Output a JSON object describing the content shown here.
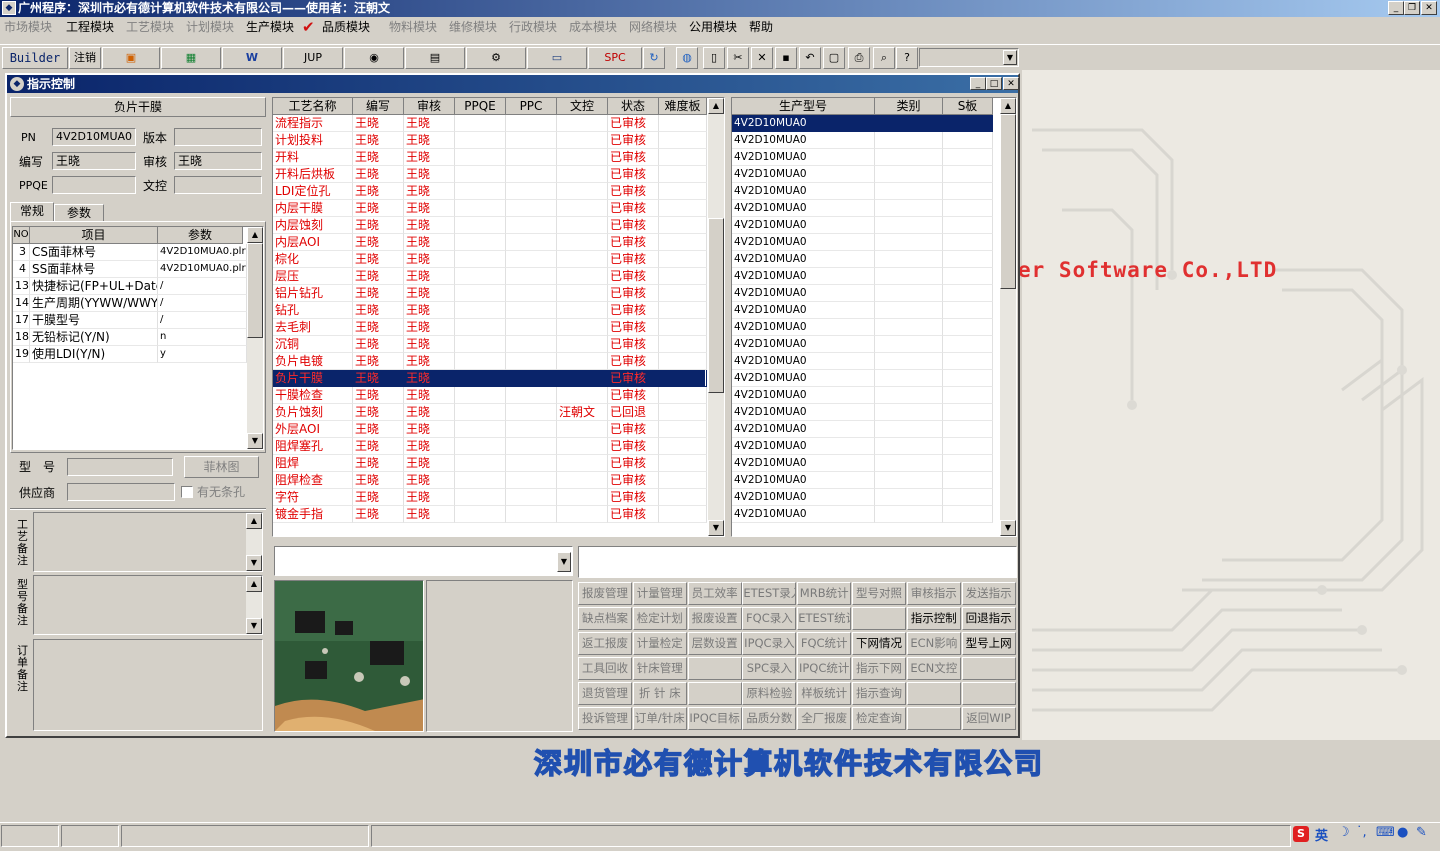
{
  "window": {
    "title": "广州程序：深圳市必有德计算机软件技术有限公司——使用者：汪朝文"
  },
  "menu": [
    {
      "label": "市场模块",
      "enabled": false
    },
    {
      "label": "工程模块",
      "enabled": true
    },
    {
      "label": "工艺模块",
      "enabled": false
    },
    {
      "label": "计划模块",
      "enabled": false
    },
    {
      "label": "生产模块",
      "enabled": true
    },
    {
      "label": "品质模块",
      "enabled": true
    },
    {
      "label": "物料模块",
      "enabled": false
    },
    {
      "label": "维修模块",
      "enabled": false
    },
    {
      "label": "行政模块",
      "enabled": false
    },
    {
      "label": "成本模块",
      "enabled": false
    },
    {
      "label": "网络模块",
      "enabled": false
    },
    {
      "label": "公用模块",
      "enabled": true
    },
    {
      "label": "帮助",
      "enabled": true
    }
  ],
  "toolbar": {
    "builder": "Builder",
    "logout": "注销",
    "jup": "JUP",
    "spc": "SPC"
  },
  "child": {
    "title": "指示控制"
  },
  "left": {
    "panel_title": "负片干膜",
    "pn_label": "PN",
    "pn_value": "4V2D10MUA0",
    "version_label": "版本",
    "version_value": "",
    "author_label": "编写",
    "author_value": "王晓",
    "reviewer_label": "审核",
    "reviewer_value": "王晓",
    "ppqe_label": "PPQE",
    "ppqe_value": "",
    "doc_label": "文控",
    "doc_value": "",
    "tabs": [
      "常规",
      "参数"
    ],
    "param_headers": [
      "NO",
      "项目",
      "参数"
    ],
    "params": [
      {
        "no": "3",
        "item": "CS面菲林号",
        "value": "4V2D10MUA0.plr"
      },
      {
        "no": "4",
        "item": "SS面菲林号",
        "value": "4V2D10MUA0.plr"
      },
      {
        "no": "13",
        "item": "快捷标记(FP+UL+DateC",
        "value": "/"
      },
      {
        "no": "14",
        "item": "生产周期(YYWW/WWYY)",
        "value": "/"
      },
      {
        "no": "17",
        "item": "干膜型号",
        "value": "/"
      },
      {
        "no": "18",
        "item": "无铅标记(Y/N)",
        "value": "n"
      },
      {
        "no": "19",
        "item": "使用LDI(Y/N)",
        "value": "y"
      }
    ],
    "model_label": "型　号",
    "film_button": "菲林图",
    "supplier_label": "供应商",
    "slot_checkbox": "有无条孔",
    "memo_labels": [
      "工艺备注",
      "型号备注",
      "订单备注"
    ]
  },
  "process": {
    "headers": [
      "工艺名称",
      "编写",
      "审核",
      "PPQE",
      "PPC",
      "文控",
      "状态",
      "难度板"
    ],
    "rows": [
      [
        "流程指示",
        "王晓",
        "王晓",
        "",
        "",
        "",
        "已审核",
        ""
      ],
      [
        "计划投料",
        "王晓",
        "王晓",
        "",
        "",
        "",
        "已审核",
        ""
      ],
      [
        "开料",
        "王晓",
        "王晓",
        "",
        "",
        "",
        "已审核",
        ""
      ],
      [
        "开料后烘板",
        "王晓",
        "王晓",
        "",
        "",
        "",
        "已审核",
        ""
      ],
      [
        "LDI定位孔",
        "王晓",
        "王晓",
        "",
        "",
        "",
        "已审核",
        ""
      ],
      [
        "内层干膜",
        "王晓",
        "王晓",
        "",
        "",
        "",
        "已审核",
        ""
      ],
      [
        "内层蚀刻",
        "王晓",
        "王晓",
        "",
        "",
        "",
        "已审核",
        ""
      ],
      [
        "内层AOI",
        "王晓",
        "王晓",
        "",
        "",
        "",
        "已审核",
        ""
      ],
      [
        "棕化",
        "王晓",
        "王晓",
        "",
        "",
        "",
        "已审核",
        ""
      ],
      [
        "层压",
        "王晓",
        "王晓",
        "",
        "",
        "",
        "已审核",
        ""
      ],
      [
        "铝片钻孔",
        "王晓",
        "王晓",
        "",
        "",
        "",
        "已审核",
        ""
      ],
      [
        "钻孔",
        "王晓",
        "王晓",
        "",
        "",
        "",
        "已审核",
        ""
      ],
      [
        "去毛刺",
        "王晓",
        "王晓",
        "",
        "",
        "",
        "已审核",
        ""
      ],
      [
        "沉铜",
        "王晓",
        "王晓",
        "",
        "",
        "",
        "已审核",
        ""
      ],
      [
        "负片电镀",
        "王晓",
        "王晓",
        "",
        "",
        "",
        "已审核",
        ""
      ],
      [
        "负片干膜",
        "王晓",
        "王晓",
        "",
        "",
        "",
        "已审核",
        ""
      ],
      [
        "干膜检查",
        "王晓",
        "王晓",
        "",
        "",
        "",
        "已审核",
        ""
      ],
      [
        "负片蚀刻",
        "王晓",
        "王晓",
        "",
        "",
        "汪朝文",
        "已回退",
        ""
      ],
      [
        "外层AOI",
        "王晓",
        "王晓",
        "",
        "",
        "",
        "已审核",
        ""
      ],
      [
        "阻焊塞孔",
        "王晓",
        "王晓",
        "",
        "",
        "",
        "已审核",
        ""
      ],
      [
        "阻焊",
        "王晓",
        "王晓",
        "",
        "",
        "",
        "已审核",
        ""
      ],
      [
        "阻焊检查",
        "王晓",
        "王晓",
        "",
        "",
        "",
        "已审核",
        ""
      ],
      [
        "字符",
        "王晓",
        "王晓",
        "",
        "",
        "",
        "已审核",
        ""
      ],
      [
        "镀金手指",
        "王晓",
        "王晓",
        "",
        "",
        "",
        "已审核",
        ""
      ]
    ],
    "selected": 15
  },
  "models": {
    "headers": [
      "生产型号",
      "类别",
      "S板"
    ],
    "rows": [
      "4V2D10MUA0",
      "4V2D10MUA0",
      "4V2D10MUA0",
      "4V2D10MUA0",
      "4V2D10MUA0",
      "4V2D10MUA0",
      "4V2D10MUA0",
      "4V2D10MUA0",
      "4V2D10MUA0",
      "4V2D10MUA0",
      "4V2D10MUA0",
      "4V2D10MUA0",
      "4V2D10MUA0",
      "4V2D10MUA0",
      "4V2D10MUA0",
      "4V2D10MUA0",
      "4V2D10MUA0",
      "4V2D10MUA0",
      "4V2D10MUA0",
      "4V2D10MUA0",
      "4V2D10MUA0",
      "4V2D10MUA0",
      "4V2D10MUA0",
      "4V2D10MUA0"
    ]
  },
  "func_buttons": [
    [
      {
        "l": "报废管理",
        "e": false
      },
      {
        "l": "计量管理",
        "e": false
      },
      {
        "l": "员工效率",
        "e": false
      },
      {
        "l": "ETEST录入",
        "e": false
      },
      {
        "l": "MRB统计",
        "e": false
      },
      {
        "l": "型号对照",
        "e": false
      },
      {
        "l": "审核指示",
        "e": false
      },
      {
        "l": "发送指示",
        "e": false
      }
    ],
    [
      {
        "l": "缺点档案",
        "e": false
      },
      {
        "l": "检定计划",
        "e": false
      },
      {
        "l": "报废设置",
        "e": false
      },
      {
        "l": "FQC录入",
        "e": false
      },
      {
        "l": "ETEST统计",
        "e": false
      },
      {
        "l": "",
        "e": false
      },
      {
        "l": "指示控制",
        "e": true
      },
      {
        "l": "回退指示",
        "e": true
      }
    ],
    [
      {
        "l": "返工报废",
        "e": false
      },
      {
        "l": "计量检定",
        "e": false
      },
      {
        "l": "层数设置",
        "e": false
      },
      {
        "l": "IPQC录入",
        "e": false
      },
      {
        "l": "FQC统计",
        "e": false
      },
      {
        "l": "下网情况",
        "e": true
      },
      {
        "l": "ECN影响",
        "e": false
      },
      {
        "l": "型号上网",
        "e": true
      }
    ],
    [
      {
        "l": "工具回收",
        "e": false
      },
      {
        "l": "针床管理",
        "e": false
      },
      {
        "l": "",
        "e": false
      },
      {
        "l": "SPC录入",
        "e": false
      },
      {
        "l": "IPQC统计",
        "e": false
      },
      {
        "l": "指示下网",
        "e": false
      },
      {
        "l": "ECN文控",
        "e": false
      },
      {
        "l": "",
        "e": false
      }
    ],
    [
      {
        "l": "退货管理",
        "e": false
      },
      {
        "l": "折 针 床",
        "e": false
      },
      {
        "l": "",
        "e": false
      },
      {
        "l": "原料检验",
        "e": false
      },
      {
        "l": "样板统计",
        "e": false
      },
      {
        "l": "指示查询",
        "e": false
      },
      {
        "l": "",
        "e": false
      },
      {
        "l": "",
        "e": false
      }
    ],
    [
      {
        "l": "投诉管理",
        "e": false
      },
      {
        "l": "订单/针床",
        "e": false
      },
      {
        "l": "IPQC目标",
        "e": false
      },
      {
        "l": "品质分数",
        "e": false
      },
      {
        "l": "全厂报废",
        "e": false
      },
      {
        "l": "检定查询",
        "e": false
      },
      {
        "l": "",
        "e": false
      },
      {
        "l": "返回WIP",
        "e": false
      }
    ]
  ],
  "background": {
    "logo_text": "er Software Co.,LTD",
    "slogan": "深圳市必有德计算机软件技术有限公司"
  },
  "tray": {
    "ime": "英"
  },
  "colors": {
    "title": "#0a246a",
    "selection": "#0a246a",
    "process_text": "#e00000"
  }
}
